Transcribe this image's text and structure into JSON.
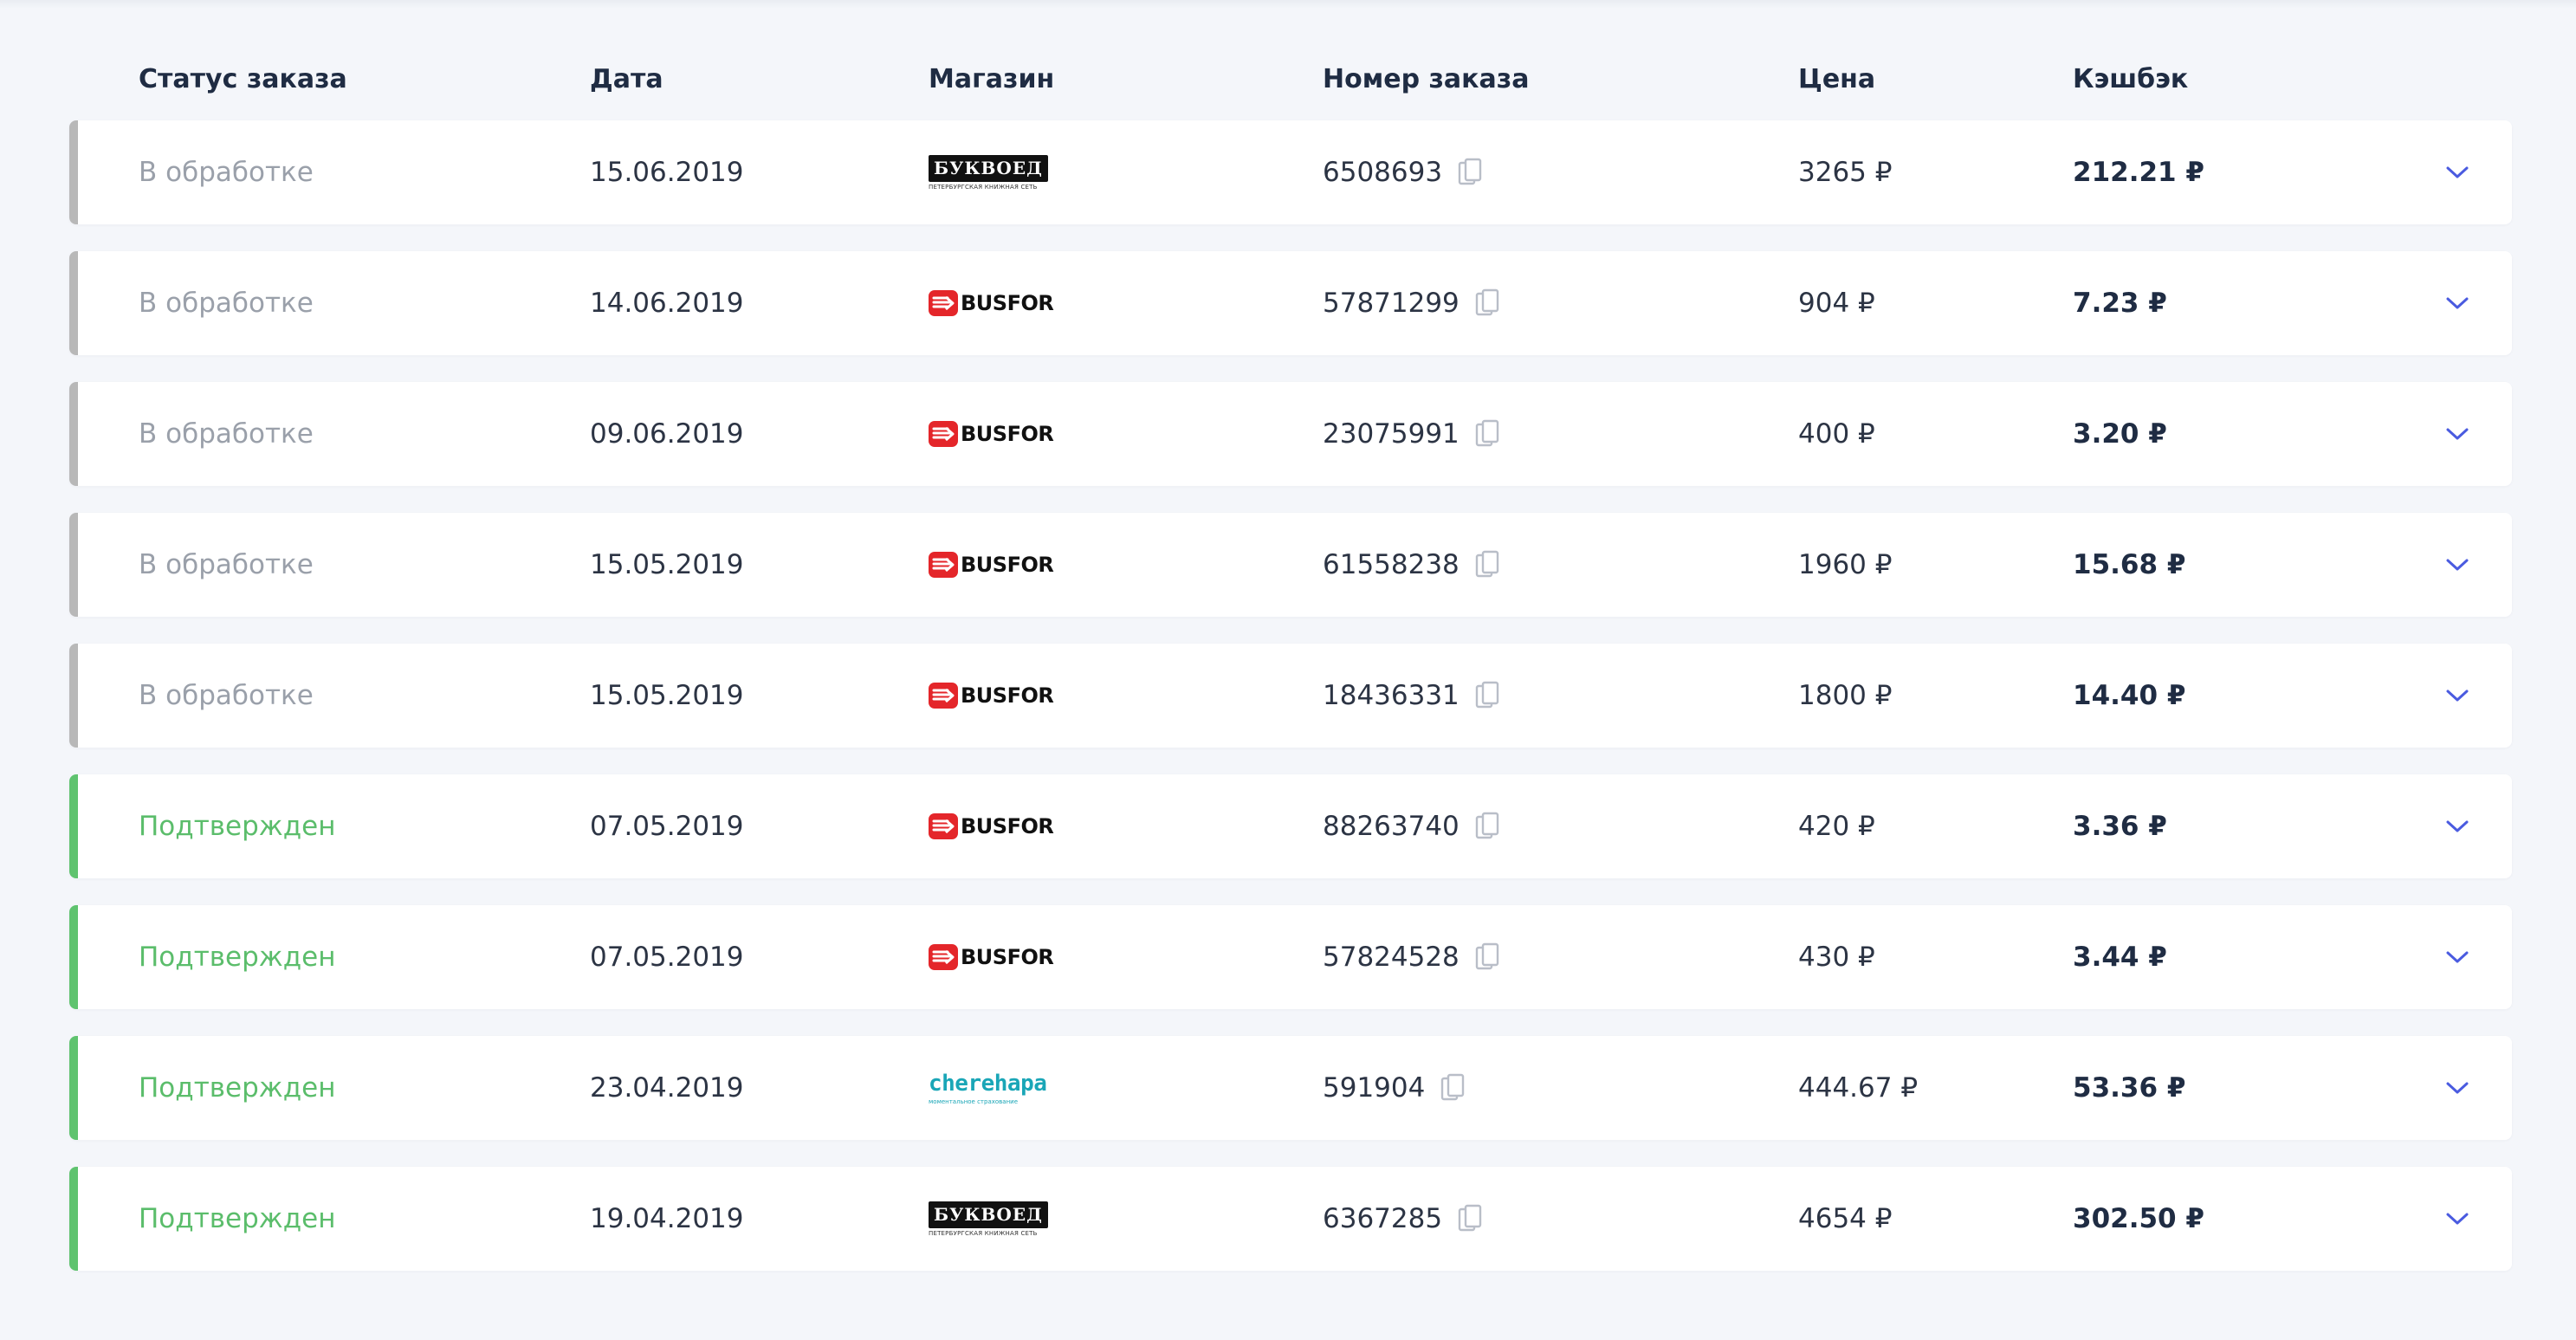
{
  "header": {
    "status": "Статус заказа",
    "date": "Дата",
    "shop": "Магазин",
    "order_number": "Номер заказа",
    "price": "Цена",
    "cashback": "Кэшбэк"
  },
  "colors": {
    "processing_accent": "#b8b8b8",
    "confirmed_accent": "#5fc36f",
    "chevron": "#4a5be0"
  },
  "logos": {
    "bukvoed": {
      "name": "БУКВОЕД",
      "tagline": "ПЕТЕРБУРГСКАЯ КНИЖНАЯ СЕТЬ"
    },
    "busfor": {
      "name": "BUSFOR"
    },
    "cherehapa": {
      "name": "cherehapa",
      "tagline": "моментальное страхование"
    }
  },
  "icons": {
    "copy": "copy-icon",
    "expand": "chevron-down-icon"
  },
  "orders": [
    {
      "status": "В обработке",
      "state": "processing",
      "date": "15.06.2019",
      "shop": "bukvoed",
      "number": "6508693",
      "price": "3265 ₽",
      "cashback": "212.21 ₽"
    },
    {
      "status": "В обработке",
      "state": "processing",
      "date": "14.06.2019",
      "shop": "busfor",
      "number": "57871299",
      "price": "904 ₽",
      "cashback": "7.23 ₽"
    },
    {
      "status": "В обработке",
      "state": "processing",
      "date": "09.06.2019",
      "shop": "busfor",
      "number": "23075991",
      "price": "400 ₽",
      "cashback": "3.20 ₽"
    },
    {
      "status": "В обработке",
      "state": "processing",
      "date": "15.05.2019",
      "shop": "busfor",
      "number": "61558238",
      "price": "1960 ₽",
      "cashback": "15.68 ₽"
    },
    {
      "status": "В обработке",
      "state": "processing",
      "date": "15.05.2019",
      "shop": "busfor",
      "number": "18436331",
      "price": "1800 ₽",
      "cashback": "14.40 ₽"
    },
    {
      "status": "Подтвержден",
      "state": "confirmed",
      "date": "07.05.2019",
      "shop": "busfor",
      "number": "88263740",
      "price": "420 ₽",
      "cashback": "3.36 ₽"
    },
    {
      "status": "Подтвержден",
      "state": "confirmed",
      "date": "07.05.2019",
      "shop": "busfor",
      "number": "57824528",
      "price": "430 ₽",
      "cashback": "3.44 ₽"
    },
    {
      "status": "Подтвержден",
      "state": "confirmed",
      "date": "23.04.2019",
      "shop": "cherehapa",
      "number": "591904",
      "price": "444.67 ₽",
      "cashback": "53.36 ₽"
    },
    {
      "status": "Подтвержден",
      "state": "confirmed",
      "date": "19.04.2019",
      "shop": "bukvoed",
      "number": "6367285",
      "price": "4654 ₽",
      "cashback": "302.50 ₽"
    }
  ]
}
